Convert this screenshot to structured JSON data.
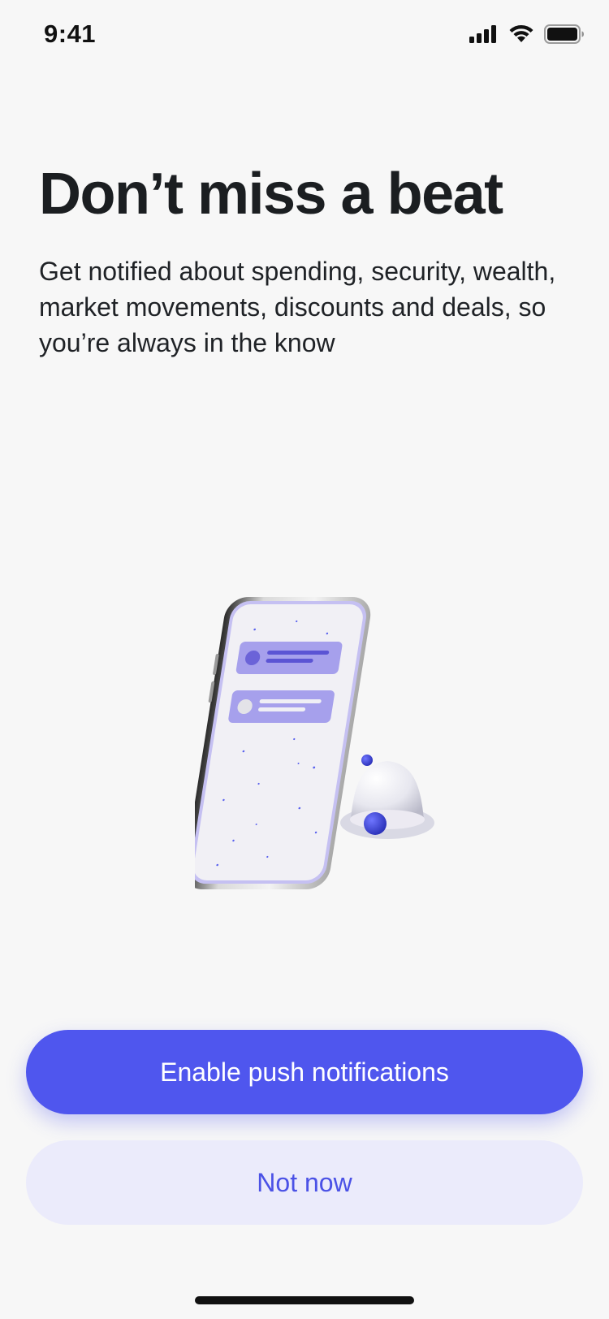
{
  "status_bar": {
    "time": "9:41",
    "icons": [
      "cellular-signal-icon",
      "wifi-icon",
      "battery-icon"
    ]
  },
  "onboarding": {
    "title": "Don’t miss a beat",
    "description": "Get notified about spending, security, wealth, market movements, discounts and deals, so you’re always in the know",
    "illustration": "phone-with-notification-bell-illustration"
  },
  "actions": {
    "primary_label": "Enable push notifications",
    "secondary_label": "Not now"
  },
  "colors": {
    "background": "#f7f7f7",
    "accent": "#4f56ee",
    "secondary_button_bg": "#ebebfb",
    "text": "#1b1e21"
  }
}
